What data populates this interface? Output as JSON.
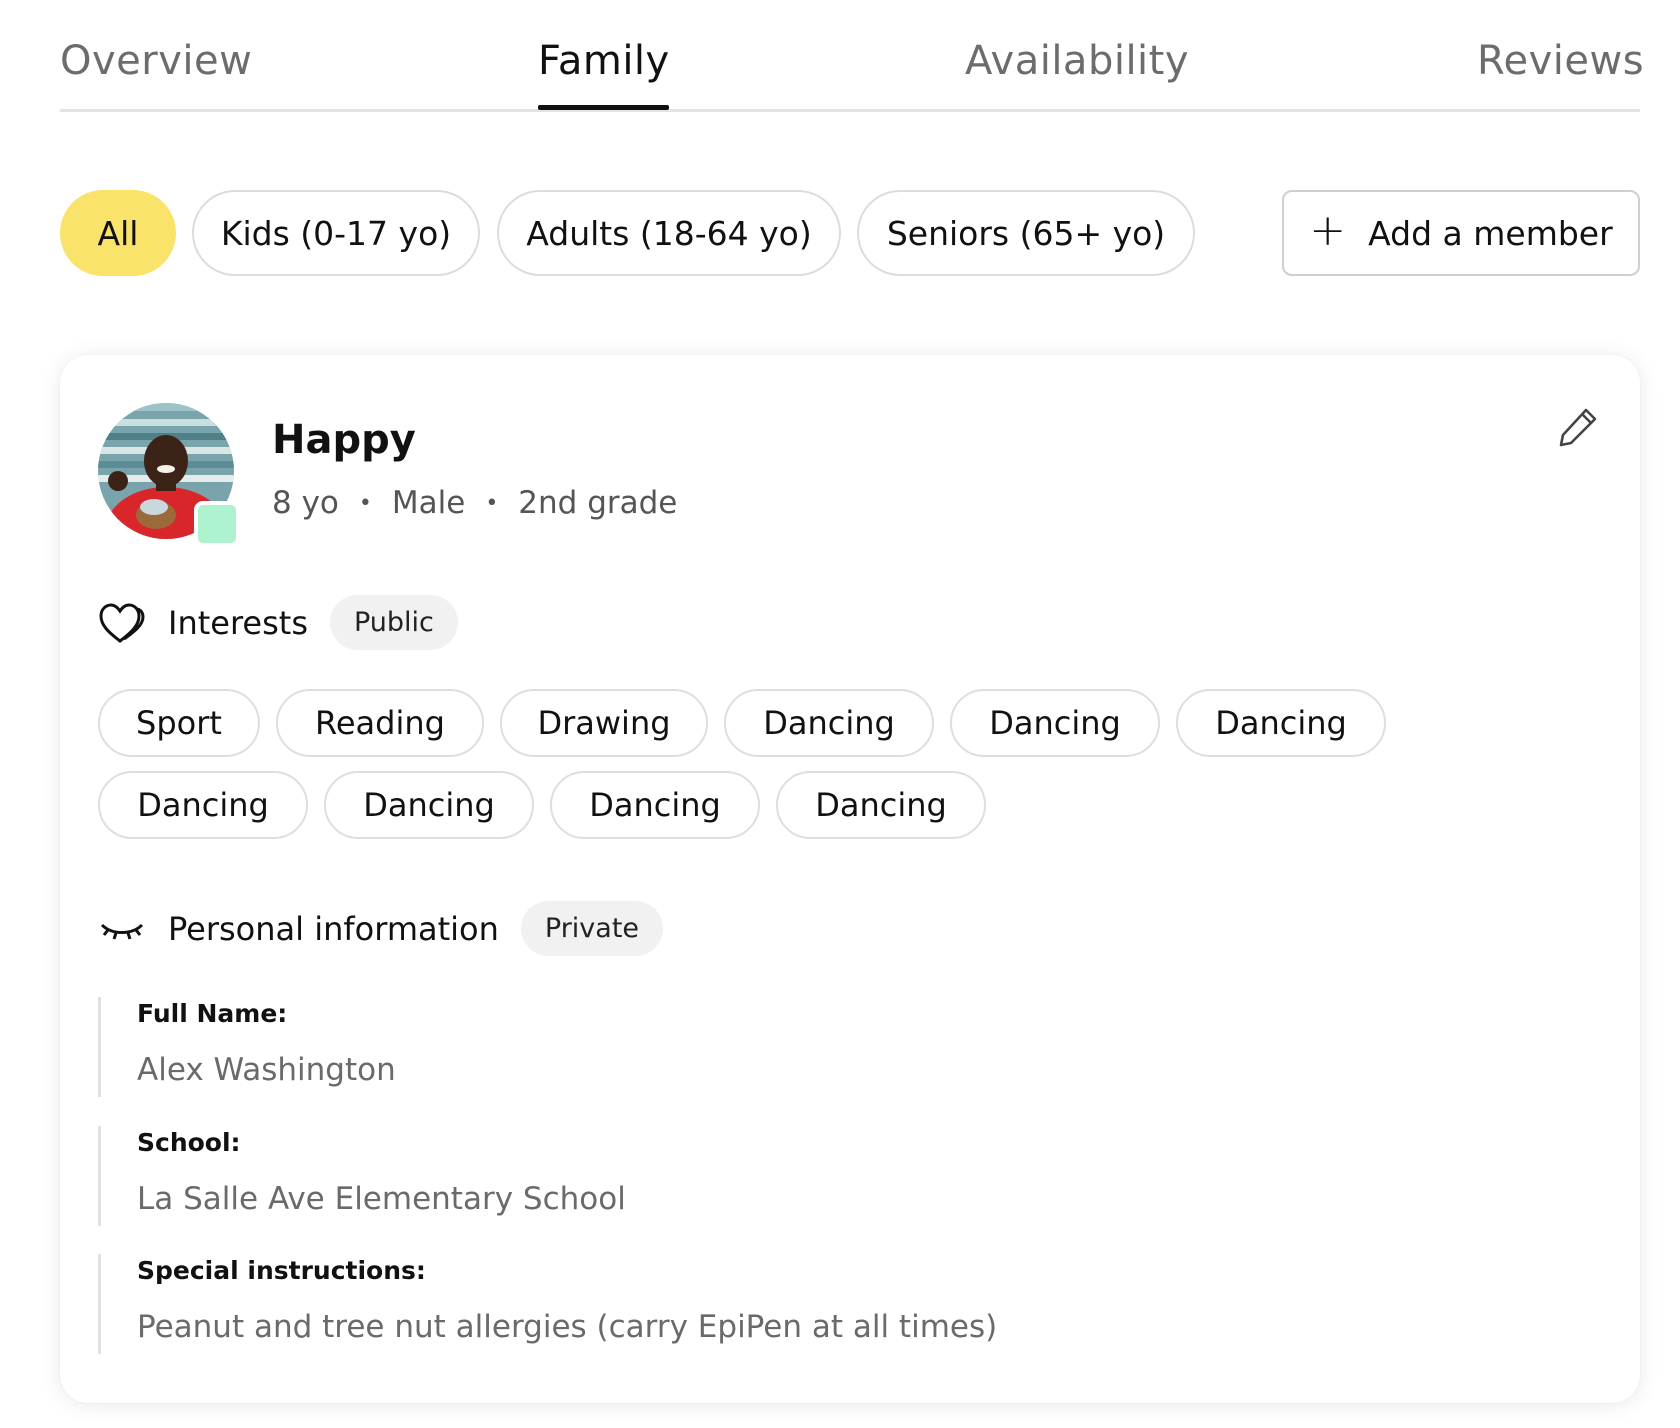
{
  "tabs": [
    {
      "label": "Overview"
    },
    {
      "label": "Family"
    },
    {
      "label": "Availability"
    },
    {
      "label": "Reviews"
    }
  ],
  "filters": [
    {
      "label": "All"
    },
    {
      "label": "Kids (0-17 yo)"
    },
    {
      "label": "Adults (18-64 yo)"
    },
    {
      "label": "Seniors (65+ yo)"
    }
  ],
  "add_member": {
    "plus": "+",
    "label": "Add a member"
  },
  "member": {
    "name": "Happy",
    "age": "8 yo",
    "gender": "Male",
    "grade": "2nd grade",
    "separator": "•"
  },
  "interests": {
    "title": "Interests",
    "badge": "Public",
    "items": [
      "Sport",
      "Reading",
      "Drawing",
      "Dancing",
      "Dancing",
      "Dancing",
      "Dancing",
      "Dancing",
      "Dancing",
      "Dancing"
    ]
  },
  "personal": {
    "title": "Personal information",
    "badge": "Private",
    "fields": [
      {
        "label": "Full Name:",
        "value": "Alex Washington"
      },
      {
        "label": "School:",
        "value": "La Salle Ave Elementary School"
      },
      {
        "label": "Special instructions:",
        "value": "Peanut and tree nut allergies (carry EpiPen at all times)"
      }
    ]
  },
  "colors": {
    "accent": "#f9e36a",
    "status_green": "#aef2cf"
  },
  "icons": [
    "heart-icon",
    "closed-eye-icon",
    "pencil-icon",
    "plus-icon"
  ]
}
